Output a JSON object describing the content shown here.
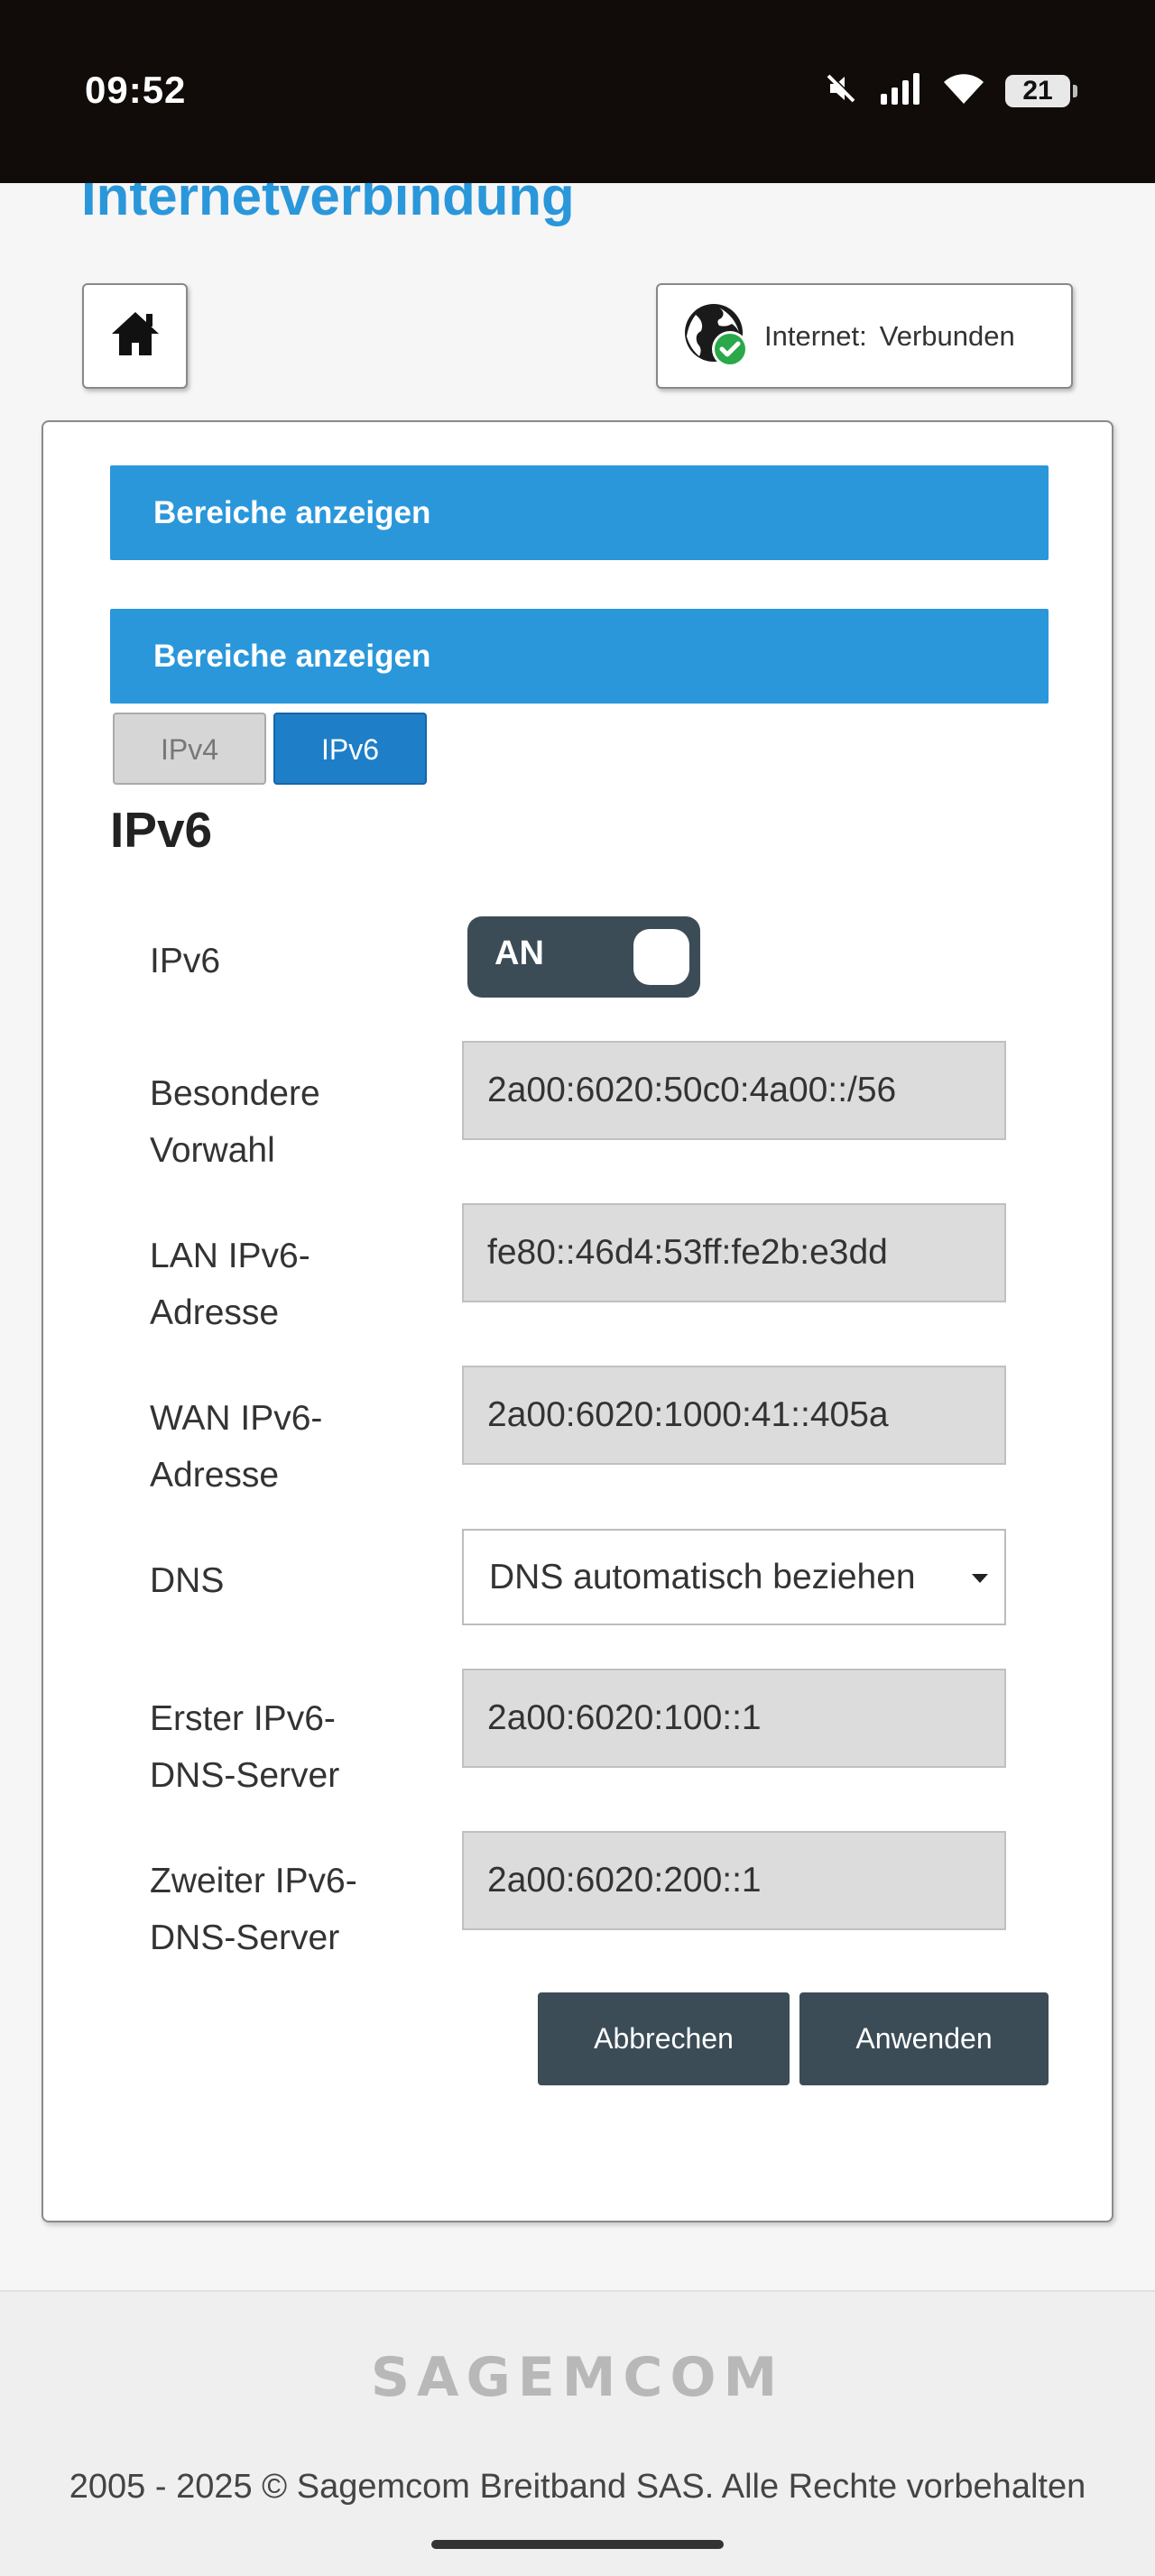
{
  "status_bar": {
    "time": "09:52",
    "battery": "21",
    "icons": [
      "mute-icon",
      "signal-icon",
      "wifi-icon",
      "battery-icon"
    ]
  },
  "header": {
    "title": "Internetverbindung",
    "internet_label": "Internet:",
    "internet_status": "Verbunden"
  },
  "sections": {
    "bar1": "Bereiche anzeigen",
    "bar2": "Bereiche anzeigen"
  },
  "tabs": [
    {
      "label": "IPv4",
      "active": false
    },
    {
      "label": "IPv6",
      "active": true
    }
  ],
  "section_title": "IPv6",
  "form": {
    "ipv6_label": "IPv6",
    "toggle_state": "AN",
    "rows": [
      {
        "label_line1": "Besondere",
        "label_line2": "Vorwahl",
        "value": "2a00:6020:50c0:4a00::/56"
      },
      {
        "label_line1": "LAN IPv6-",
        "label_line2": "Adresse",
        "value": "fe80::46d4:53ff:fe2b:e3dd"
      },
      {
        "label_line1": "WAN IPv6-",
        "label_line2": "Adresse",
        "value": "2a00:6020:1000:41::405a"
      }
    ],
    "dns_label": "DNS",
    "dns_value": "DNS automatisch beziehen",
    "dns_rows": [
      {
        "label_line1": "Erster IPv6-",
        "label_line2": "DNS-Server",
        "value": "2a00:6020:100::1"
      },
      {
        "label_line1": "Zweiter IPv6-",
        "label_line2": "DNS-Server",
        "value": "2a00:6020:200::1"
      }
    ]
  },
  "buttons": {
    "cancel": "Abbrechen",
    "apply": "Anwenden"
  },
  "footer": {
    "logo": "SAGEMCOM",
    "copyright": "2005 - 2025 © Sagemcom Breitband SAS. Alle Rechte vorbehalten"
  },
  "colors": {
    "accent": "#2a97da",
    "dark_button": "#3b4c57",
    "status_ok": "#2aa84a"
  }
}
